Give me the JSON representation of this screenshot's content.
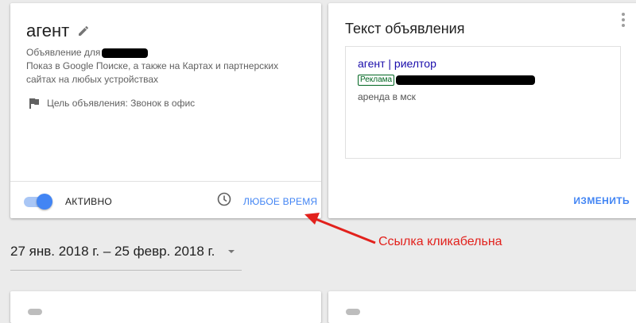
{
  "campaign_card": {
    "title": "агент",
    "desc_line1_prefix": "Объявление для",
    "desc_line2": "Показ в Google Поиске, а также на Картах и партнерских",
    "desc_line3": "сайтах на любых устройствах",
    "goal": "Цель объявления: Звонок в офис",
    "status_label": "АКТИВНО",
    "schedule_link": "ЛЮБОЕ ВРЕМЯ"
  },
  "ad_text_card": {
    "title": "Текст объявления",
    "headline": "агент | риелтор",
    "badge": "Реклама",
    "description": "аренда в мск",
    "change_label": "ИЗМЕНИТЬ"
  },
  "date_range": {
    "label": "27 янв. 2018 г. – 25 февр. 2018 г."
  },
  "annotation": {
    "text": "Ссылка кликабельна",
    "color": "#e2211c"
  },
  "colors": {
    "accent": "#4285f4",
    "ad_headline": "#1a0dab",
    "ad_badge": "#006621"
  },
  "toggle": {
    "on": true
  }
}
